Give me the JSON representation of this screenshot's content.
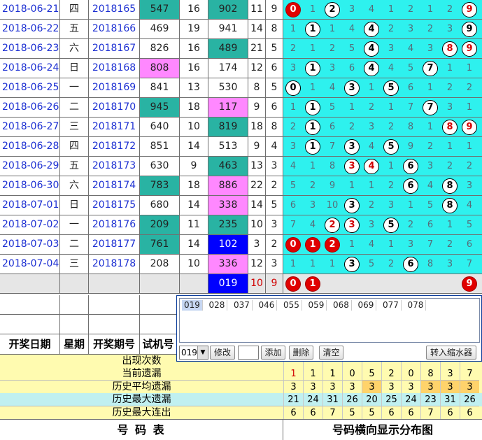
{
  "rows": [
    {
      "date": "2018-06-21",
      "week": "四",
      "issue": "2018165",
      "n1": "547",
      "n2": "16",
      "n3": "902",
      "n4": "11",
      "n5": "9",
      "c1": "teal",
      "c3": "teal",
      "dist": [
        {
          "t": "0",
          "b": "r"
        },
        {
          "t": "1",
          "b": "n"
        },
        {
          "t": "2",
          "b": "w"
        },
        {
          "t": "3",
          "b": "n"
        },
        {
          "t": "4",
          "b": "n"
        },
        {
          "t": "1",
          "b": "n"
        },
        {
          "t": "2",
          "b": "n"
        },
        {
          "t": "1",
          "b": "n"
        },
        {
          "t": "2",
          "b": "n"
        },
        {
          "t": "9",
          "b": "wr"
        }
      ]
    },
    {
      "date": "2018-06-22",
      "week": "五",
      "issue": "2018166",
      "n1": "469",
      "n2": "19",
      "n3": "941",
      "n4": "14",
      "n5": "8",
      "c1": "",
      "c3": "",
      "dist": [
        {
          "t": "1",
          "b": "n"
        },
        {
          "t": "1",
          "b": "w"
        },
        {
          "t": "1",
          "b": "n"
        },
        {
          "t": "4",
          "b": "n"
        },
        {
          "t": "4",
          "b": "w"
        },
        {
          "t": "2",
          "b": "n"
        },
        {
          "t": "3",
          "b": "n"
        },
        {
          "t": "2",
          "b": "n"
        },
        {
          "t": "3",
          "b": "n"
        },
        {
          "t": "9",
          "b": "w"
        }
      ]
    },
    {
      "date": "2018-06-23",
      "week": "六",
      "issue": "2018167",
      "n1": "826",
      "n2": "16",
      "n3": "489",
      "n4": "21",
      "n5": "5",
      "c1": "",
      "c3": "teal",
      "dist": [
        {
          "t": "2",
          "b": "n"
        },
        {
          "t": "1",
          "b": "n"
        },
        {
          "t": "2",
          "b": "n"
        },
        {
          "t": "5",
          "b": "n"
        },
        {
          "t": "4",
          "b": "w"
        },
        {
          "t": "3",
          "b": "n"
        },
        {
          "t": "4",
          "b": "n"
        },
        {
          "t": "3",
          "b": "n"
        },
        {
          "t": "8",
          "b": "wr"
        },
        {
          "t": "9",
          "b": "wr"
        }
      ]
    },
    {
      "date": "2018-06-24",
      "week": "日",
      "issue": "2018168",
      "n1": "808",
      "n2": "16",
      "n3": "174",
      "n4": "12",
      "n5": "6",
      "c1": "pink",
      "c3": "",
      "dist": [
        {
          "t": "3",
          "b": "n"
        },
        {
          "t": "1",
          "b": "w"
        },
        {
          "t": "3",
          "b": "n"
        },
        {
          "t": "6",
          "b": "n"
        },
        {
          "t": "4",
          "b": "w"
        },
        {
          "t": "4",
          "b": "n"
        },
        {
          "t": "5",
          "b": "n"
        },
        {
          "t": "7",
          "b": "w"
        },
        {
          "t": "1",
          "b": "n"
        },
        {
          "t": "1",
          "b": "n"
        }
      ]
    },
    {
      "date": "2018-06-25",
      "week": "一",
      "issue": "2018169",
      "n1": "841",
      "n2": "13",
      "n3": "530",
      "n4": "8",
      "n5": "5",
      "c1": "",
      "c3": "",
      "dist": [
        {
          "t": "0",
          "b": "w"
        },
        {
          "t": "1",
          "b": "n"
        },
        {
          "t": "4",
          "b": "n"
        },
        {
          "t": "3",
          "b": "w"
        },
        {
          "t": "1",
          "b": "n"
        },
        {
          "t": "5",
          "b": "w"
        },
        {
          "t": "6",
          "b": "n"
        },
        {
          "t": "1",
          "b": "n"
        },
        {
          "t": "2",
          "b": "n"
        },
        {
          "t": "2",
          "b": "n"
        }
      ]
    },
    {
      "date": "2018-06-26",
      "week": "二",
      "issue": "2018170",
      "n1": "945",
      "n2": "18",
      "n3": "117",
      "n4": "9",
      "n5": "6",
      "c1": "teal",
      "c3": "pink",
      "dist": [
        {
          "t": "1",
          "b": "n"
        },
        {
          "t": "1",
          "b": "w"
        },
        {
          "t": "5",
          "b": "n"
        },
        {
          "t": "1",
          "b": "n"
        },
        {
          "t": "2",
          "b": "n"
        },
        {
          "t": "1",
          "b": "n"
        },
        {
          "t": "7",
          "b": "n"
        },
        {
          "t": "7",
          "b": "w"
        },
        {
          "t": "3",
          "b": "n"
        },
        {
          "t": "1",
          "b": "n"
        }
      ]
    },
    {
      "date": "2018-06-27",
      "week": "三",
      "issue": "2018171",
      "n1": "640",
      "n2": "10",
      "n3": "819",
      "n4": "18",
      "n5": "8",
      "c1": "",
      "c3": "teal",
      "dist": [
        {
          "t": "2",
          "b": "n"
        },
        {
          "t": "1",
          "b": "w"
        },
        {
          "t": "6",
          "b": "n"
        },
        {
          "t": "2",
          "b": "n"
        },
        {
          "t": "3",
          "b": "n"
        },
        {
          "t": "2",
          "b": "n"
        },
        {
          "t": "8",
          "b": "n"
        },
        {
          "t": "1",
          "b": "n"
        },
        {
          "t": "8",
          "b": "wr"
        },
        {
          "t": "9",
          "b": "wr"
        }
      ]
    },
    {
      "date": "2018-06-28",
      "week": "四",
      "issue": "2018172",
      "n1": "851",
      "n2": "14",
      "n3": "513",
      "n4": "9",
      "n5": "4",
      "c1": "",
      "c3": "",
      "dist": [
        {
          "t": "3",
          "b": "n"
        },
        {
          "t": "1",
          "b": "w"
        },
        {
          "t": "7",
          "b": "n"
        },
        {
          "t": "3",
          "b": "w"
        },
        {
          "t": "4",
          "b": "n"
        },
        {
          "t": "5",
          "b": "w"
        },
        {
          "t": "9",
          "b": "n"
        },
        {
          "t": "2",
          "b": "n"
        },
        {
          "t": "1",
          "b": "n"
        },
        {
          "t": "1",
          "b": "n"
        }
      ]
    },
    {
      "date": "2018-06-29",
      "week": "五",
      "issue": "2018173",
      "n1": "630",
      "n2": "9",
      "n3": "463",
      "n4": "13",
      "n5": "3",
      "c1": "",
      "c3": "teal",
      "dist": [
        {
          "t": "4",
          "b": "n"
        },
        {
          "t": "1",
          "b": "n"
        },
        {
          "t": "8",
          "b": "n"
        },
        {
          "t": "3",
          "b": "wr"
        },
        {
          "t": "4",
          "b": "wr"
        },
        {
          "t": "1",
          "b": "n"
        },
        {
          "t": "6",
          "b": "w"
        },
        {
          "t": "3",
          "b": "n"
        },
        {
          "t": "2",
          "b": "n"
        },
        {
          "t": "2",
          "b": "n"
        }
      ]
    },
    {
      "date": "2018-06-30",
      "week": "六",
      "issue": "2018174",
      "n1": "783",
      "n2": "18",
      "n3": "886",
      "n4": "22",
      "n5": "2",
      "c1": "teal",
      "c3": "pink",
      "dist": [
        {
          "t": "5",
          "b": "n"
        },
        {
          "t": "2",
          "b": "n"
        },
        {
          "t": "9",
          "b": "n"
        },
        {
          "t": "1",
          "b": "n"
        },
        {
          "t": "1",
          "b": "n"
        },
        {
          "t": "2",
          "b": "n"
        },
        {
          "t": "6",
          "b": "w"
        },
        {
          "t": "4",
          "b": "n"
        },
        {
          "t": "8",
          "b": "w"
        },
        {
          "t": "3",
          "b": "n"
        }
      ]
    },
    {
      "date": "2018-07-01",
      "week": "日",
      "issue": "2018175",
      "n1": "680",
      "n2": "14",
      "n3": "338",
      "n4": "14",
      "n5": "5",
      "c1": "",
      "c3": "pink",
      "dist": [
        {
          "t": "6",
          "b": "n"
        },
        {
          "t": "3",
          "b": "n"
        },
        {
          "t": "10",
          "b": "n"
        },
        {
          "t": "3",
          "b": "w"
        },
        {
          "t": "2",
          "b": "n"
        },
        {
          "t": "3",
          "b": "n"
        },
        {
          "t": "1",
          "b": "n"
        },
        {
          "t": "5",
          "b": "n"
        },
        {
          "t": "8",
          "b": "w"
        },
        {
          "t": "4",
          "b": "n"
        }
      ]
    },
    {
      "date": "2018-07-02",
      "week": "一",
      "issue": "2018176",
      "n1": "209",
      "n2": "11",
      "n3": "235",
      "n4": "10",
      "n5": "3",
      "c1": "teal",
      "c3": "teal",
      "dist": [
        {
          "t": "7",
          "b": "n"
        },
        {
          "t": "4",
          "b": "n"
        },
        {
          "t": "2",
          "b": "wr"
        },
        {
          "t": "3",
          "b": "wr"
        },
        {
          "t": "3",
          "b": "n"
        },
        {
          "t": "5",
          "b": "w"
        },
        {
          "t": "2",
          "b": "n"
        },
        {
          "t": "6",
          "b": "n"
        },
        {
          "t": "1",
          "b": "n"
        },
        {
          "t": "5",
          "b": "n"
        }
      ]
    },
    {
      "date": "2018-07-03",
      "week": "二",
      "issue": "2018177",
      "n1": "761",
      "n2": "14",
      "n3": "102",
      "n4": "3",
      "n5": "2",
      "c1": "teal",
      "c3": "blue",
      "dist": [
        {
          "t": "0",
          "b": "r"
        },
        {
          "t": "1",
          "b": "r"
        },
        {
          "t": "2",
          "b": "r"
        },
        {
          "t": "1",
          "b": "n"
        },
        {
          "t": "4",
          "b": "n"
        },
        {
          "t": "1",
          "b": "n"
        },
        {
          "t": "3",
          "b": "n"
        },
        {
          "t": "7",
          "b": "n"
        },
        {
          "t": "2",
          "b": "n"
        },
        {
          "t": "6",
          "b": "n"
        }
      ]
    },
    {
      "date": "2018-07-04",
      "week": "三",
      "issue": "2018178",
      "n1": "208",
      "n2": "10",
      "n3": "336",
      "n4": "12",
      "n5": "3",
      "c1": "",
      "c3": "pink",
      "dist": [
        {
          "t": "1",
          "b": "n"
        },
        {
          "t": "1",
          "b": "n"
        },
        {
          "t": "1",
          "b": "n"
        },
        {
          "t": "3",
          "b": "w"
        },
        {
          "t": "5",
          "b": "n"
        },
        {
          "t": "2",
          "b": "n"
        },
        {
          "t": "6",
          "b": "w"
        },
        {
          "t": "8",
          "b": "n"
        },
        {
          "t": "3",
          "b": "n"
        },
        {
          "t": "7",
          "b": "n"
        }
      ]
    }
  ],
  "summary": {
    "n3": "019",
    "n4": "10",
    "n5": "9",
    "dist": [
      {
        "t": "0",
        "b": "r"
      },
      {
        "t": "1",
        "b": "r"
      },
      {
        "t": "",
        "b": "e"
      },
      {
        "t": "",
        "b": "e"
      },
      {
        "t": "",
        "b": "e"
      },
      {
        "t": "",
        "b": "e"
      },
      {
        "t": "",
        "b": "e"
      },
      {
        "t": "",
        "b": "e"
      },
      {
        "t": "",
        "b": "e"
      },
      {
        "t": "9",
        "b": "r"
      }
    ]
  },
  "panel": {
    "chips": [
      "019",
      "028",
      "037",
      "046",
      "055",
      "059",
      "068",
      "069",
      "077",
      "078"
    ],
    "select_value": "019",
    "btn_edit": "修改",
    "btn_add": "添加",
    "btn_delete": "删除",
    "btn_clear": "清空",
    "btn_transfer": "转入缩水器"
  },
  "headers": {
    "date": "开奖日期",
    "week": "星期",
    "issue": "开奖期号",
    "trial": "试机号"
  },
  "stats": [
    {
      "label": "出现次数",
      "values": [],
      "bg": "#fffbb0"
    },
    {
      "label": "当前遗漏",
      "values": [
        "1",
        "1",
        "1",
        "0",
        "5",
        "2",
        "0",
        "8",
        "3",
        "7"
      ],
      "bg": "#fffbb0"
    },
    {
      "label": "历史平均遗漏",
      "values": [
        "3",
        "3",
        "3",
        "3",
        "3",
        "3",
        "3",
        "3",
        "3",
        "3"
      ],
      "bg": "#fffbb0"
    },
    {
      "label": "历史最大遗漏",
      "values": [
        "21",
        "24",
        "31",
        "26",
        "20",
        "25",
        "24",
        "23",
        "31",
        "26"
      ],
      "bg": "#c0f0f0"
    },
    {
      "label": "历史最大连出",
      "values": [
        "6",
        "6",
        "7",
        "5",
        "5",
        "6",
        "6",
        "7",
        "6",
        "6"
      ],
      "bg": "#fffbb0"
    }
  ],
  "footer": {
    "left": "号 码 表",
    "right": "号码横向显示分布图"
  },
  "colors": {
    "teal": "#29b3a3",
    "pink": "#ff88ff",
    "blue": "#0000ff",
    "cyan": "#2ef1ee",
    "red": "#e00000"
  }
}
